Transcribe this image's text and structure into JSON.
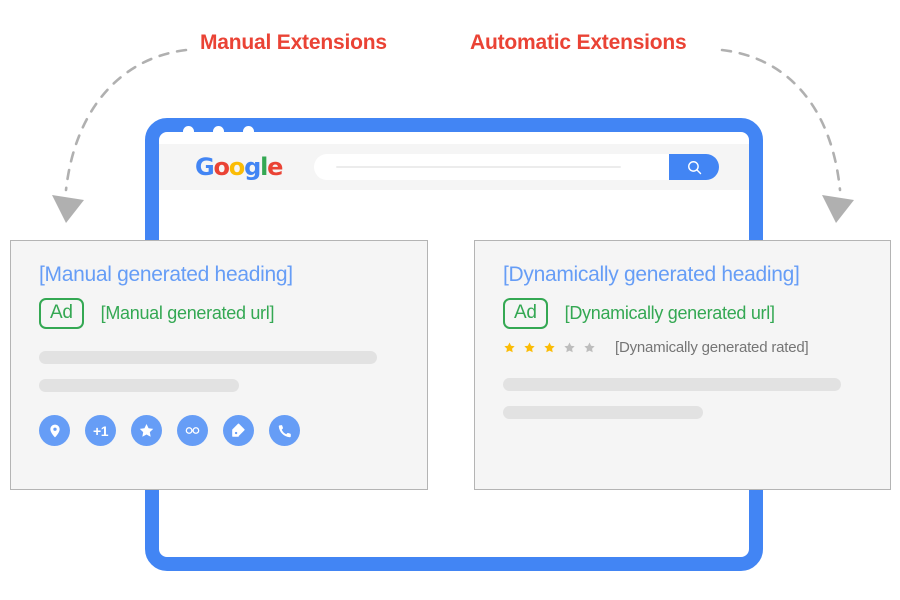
{
  "annotations": {
    "manual_label": "Manual Extensions",
    "automatic_label": "Automatic Extensions",
    "accent_color": "#ea4335"
  },
  "browser": {
    "frame_color": "#4285f4",
    "toolbar_bg": "#f5f5f5",
    "window_dots": [
      "dot-1",
      "dot-2",
      "dot-3"
    ],
    "logo": {
      "name": "google-logo",
      "letters": [
        "G",
        "o",
        "o",
        "g",
        "l",
        "e"
      ],
      "colors": [
        "#4285f4",
        "#ea4335",
        "#fbbc05",
        "#4285f4",
        "#34a853",
        "#ea4335"
      ]
    },
    "search": {
      "value": "",
      "placeholder": "",
      "button_icon": "search-icon"
    }
  },
  "cards": {
    "manual": {
      "heading": "[Manual generated heading]",
      "badge": "Ad",
      "url": "[Manual generated url]",
      "heading_color": "#669df6",
      "badge_color": "#34a853",
      "extensions": [
        {
          "name": "location-pin-icon",
          "label": ""
        },
        {
          "name": "plus-one-icon",
          "label": "+1"
        },
        {
          "name": "star-icon",
          "label": ""
        },
        {
          "name": "sitelink-icon",
          "label": ""
        },
        {
          "name": "price-tag-icon",
          "label": ""
        },
        {
          "name": "phone-icon",
          "label": ""
        }
      ]
    },
    "automatic": {
      "heading": "[Dynamically generated heading]",
      "badge": "Ad",
      "url": "[Dynamically generated url]",
      "rating_text": "[Dynamically generated rated]",
      "rating_filled": 3,
      "rating_total": 5,
      "star_filled_color": "#fbbc05",
      "star_empty_color": "#bdbdbd"
    }
  }
}
